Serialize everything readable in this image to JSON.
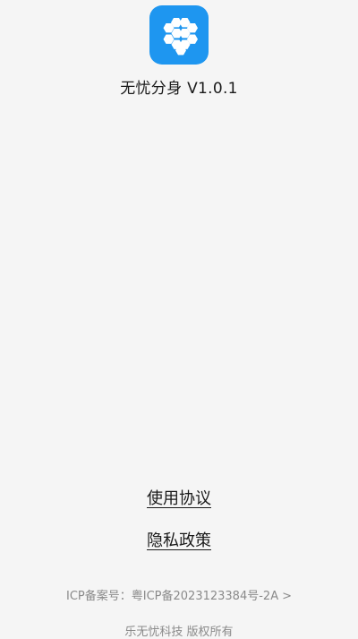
{
  "app": {
    "icon": "honeycomb-hexagon-icon",
    "name_version": "无忧分身 V1.0.1",
    "icon_color": "#1e96f0"
  },
  "links": {
    "terms": "使用协议",
    "privacy": "隐私政策"
  },
  "footer": {
    "icp_label": "ICP备案号：",
    "icp_number": "粤ICP备2023123384号-2A",
    "chevron": ">",
    "copyright": "乐无忧科技 版权所有"
  }
}
